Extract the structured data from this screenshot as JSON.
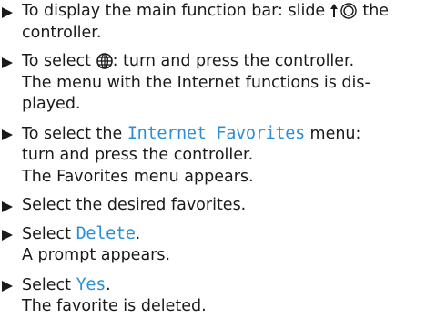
{
  "steps": [
    {
      "pre": "To display the main function bar: slide",
      "post": "the",
      "line2": "controller."
    },
    {
      "pre": "To select",
      "post": ": turn and press the controller.",
      "line2": "The menu with the Internet functions is dis-",
      "line3": "played."
    },
    {
      "pre": "To select the",
      "highlight": "Internet Favorites",
      "post": "menu:",
      "line2": "turn and press the controller.",
      "line3": "The Favorites menu appears."
    },
    {
      "text": "Select the desired favorites."
    },
    {
      "pre": "Select",
      "highlight": "Delete",
      "post": ".",
      "line2": "A prompt appears."
    },
    {
      "pre": "Select",
      "highlight": "Yes",
      "post": ".",
      "line2": "The favorite is deleted."
    }
  ],
  "colors": {
    "text": "#1a1a1a",
    "highlight": "#2a8fd6"
  },
  "icons": [
    "bullet-triangle-icon",
    "slide-up-controller-icon",
    "globe-internet-icon"
  ]
}
